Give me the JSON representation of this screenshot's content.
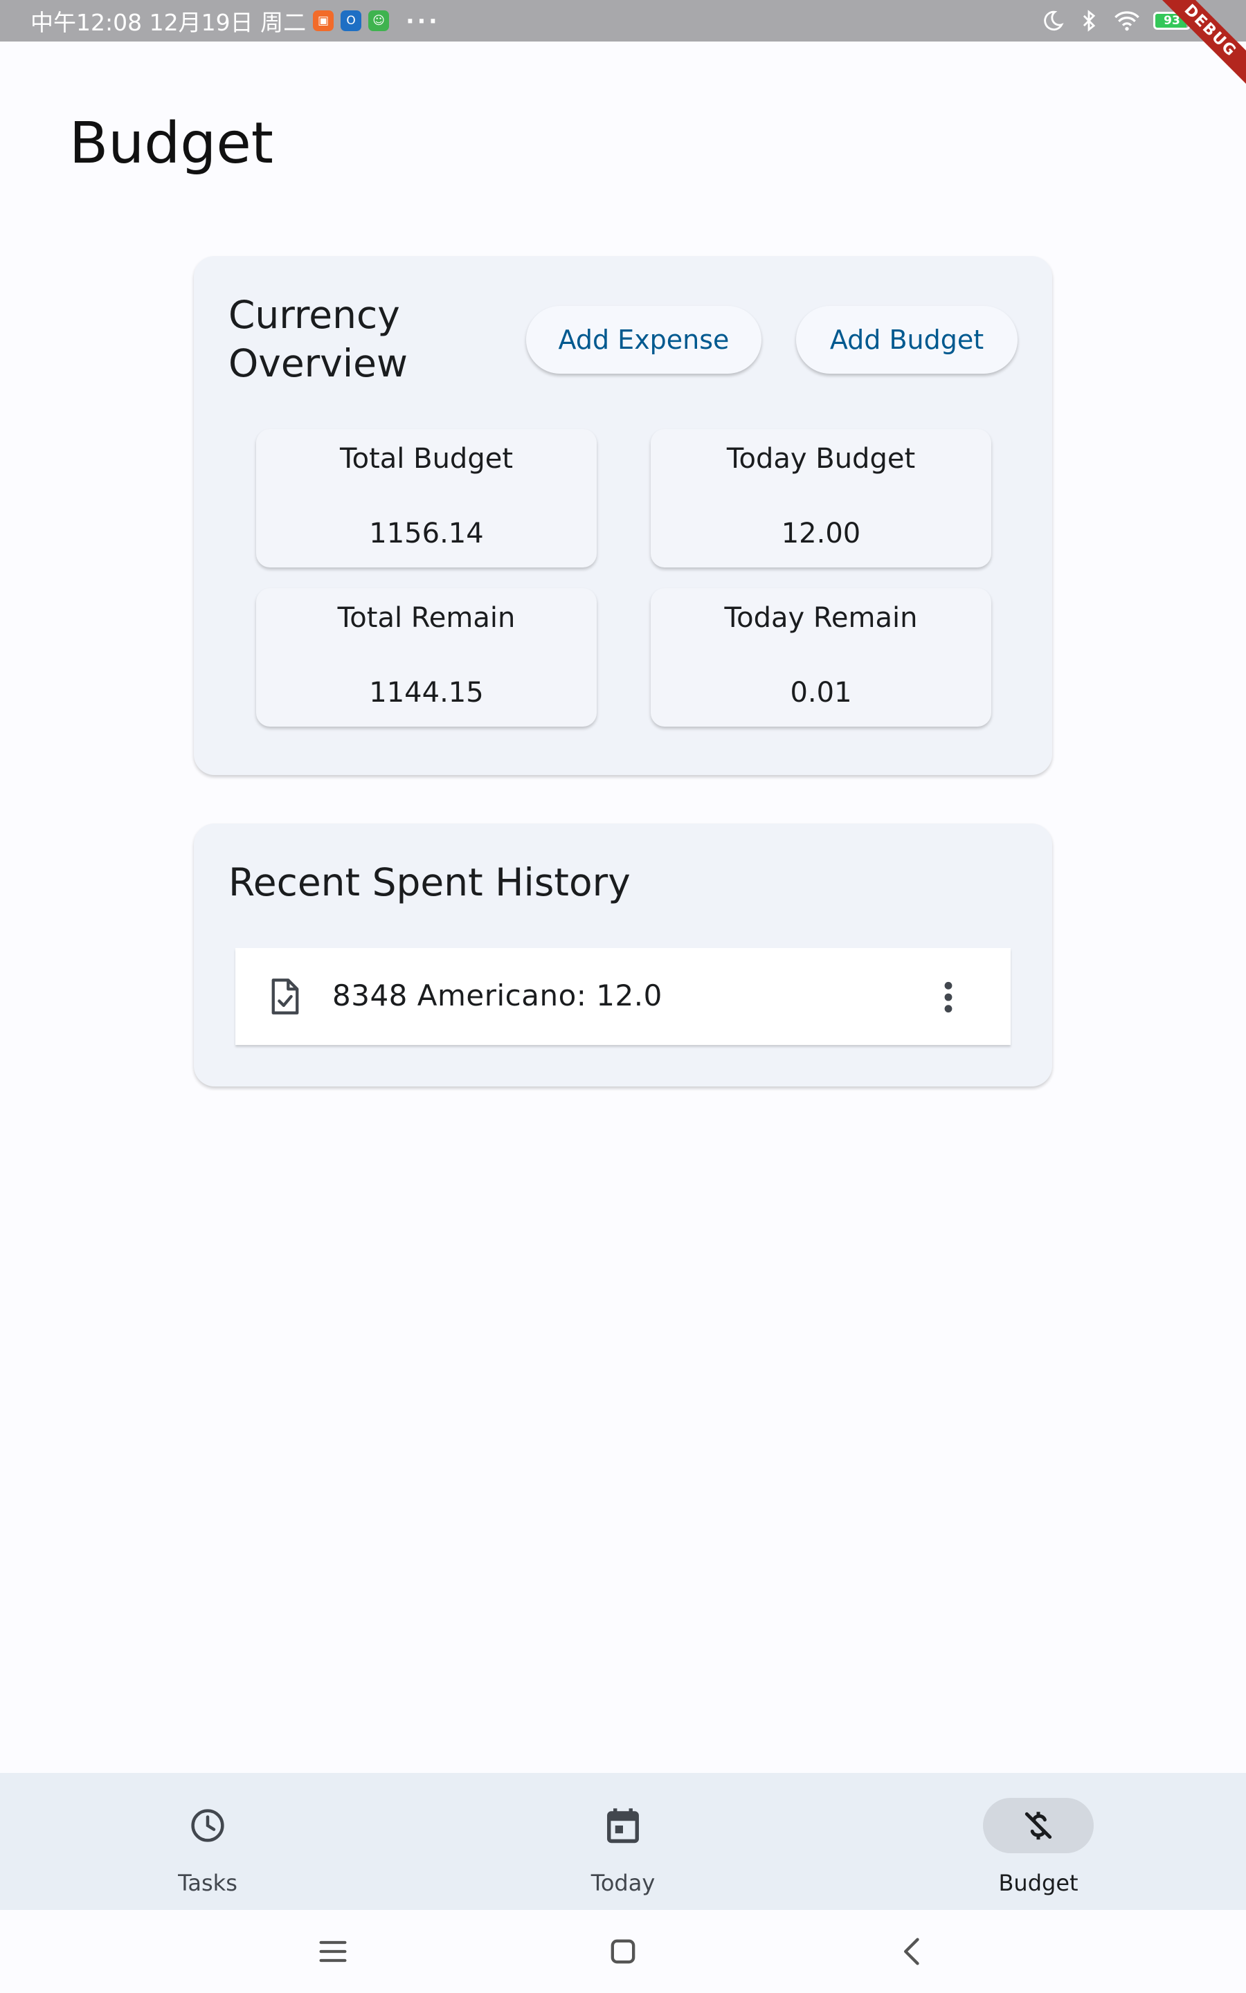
{
  "status_bar": {
    "time_text": "中午12:08 12月19日 周二",
    "dots": "···",
    "battery_level": 93,
    "battery_text": "93",
    "debug_label": "DEBUG"
  },
  "page": {
    "title": "Budget"
  },
  "overview": {
    "title": "Currency Overview",
    "add_expense_label": "Add Expense",
    "add_budget_label": "Add Budget",
    "stats": [
      {
        "label": "Total Budget",
        "value": "1156.14"
      },
      {
        "label": "Today Budget",
        "value": "12.00"
      },
      {
        "label": "Total Remain",
        "value": "1144.15"
      },
      {
        "label": "Today Remain",
        "value": "0.01"
      }
    ]
  },
  "history": {
    "title": "Recent Spent History",
    "items": [
      {
        "text": "8348 Americano: 12.0"
      }
    ]
  },
  "bottom_nav": {
    "items": [
      {
        "label": "Tasks",
        "icon": "clock-icon",
        "active": false
      },
      {
        "label": "Today",
        "icon": "calendar-icon",
        "active": false
      },
      {
        "label": "Budget",
        "icon": "money-off-icon",
        "active": true
      }
    ]
  },
  "colors": {
    "accent": "#00598f",
    "card_bg": "#f0f3f9",
    "nav_bg": "#e8eef5",
    "status_bar_bg": "#a8a8ab"
  }
}
